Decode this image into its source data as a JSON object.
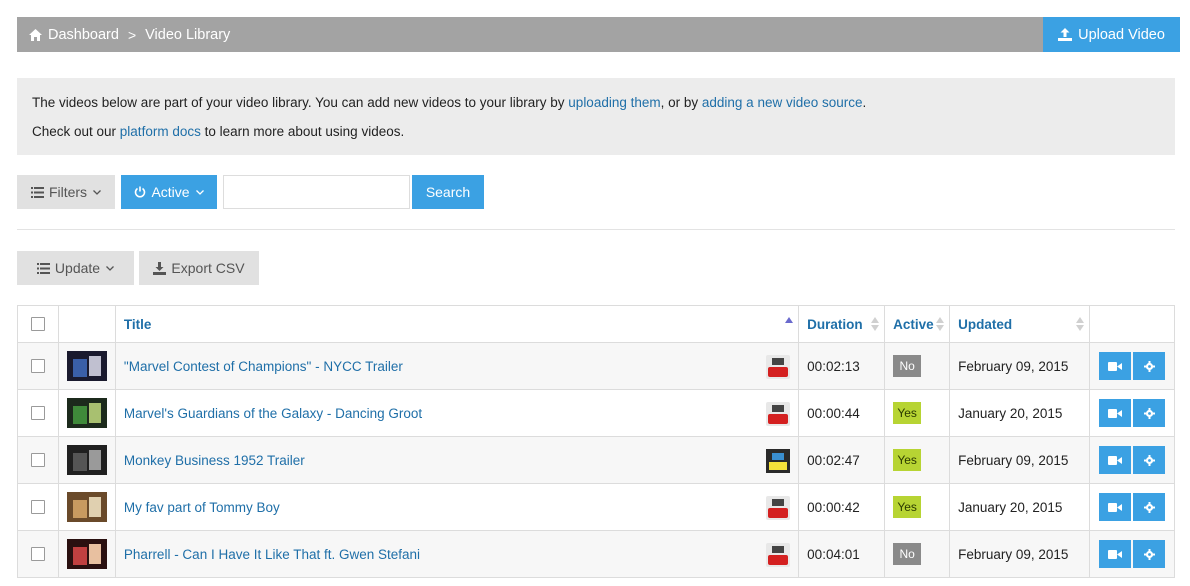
{
  "breadcrumb": {
    "home_icon": "home-icon",
    "dashboard": "Dashboard",
    "separator": ">",
    "current": "Video Library"
  },
  "upload_button": {
    "label": "Upload Video",
    "icon": "upload-icon"
  },
  "info": {
    "line1_prefix": "The videos below are part of your video library. You can add new videos to your library by ",
    "link_upload": "uploading them",
    "line1_mid": ", or by ",
    "link_source": "adding a new video source",
    "line1_suffix": ".",
    "line2_prefix": "Check out our ",
    "link_docs": "platform docs",
    "line2_suffix": " to learn more about using videos."
  },
  "filters": {
    "filters_label": "Filters",
    "active_label": "Active",
    "search_value": "",
    "search_button": "Search"
  },
  "bulk": {
    "update_label": "Update",
    "export_label": "Export CSV"
  },
  "table": {
    "headers": {
      "title": "Title",
      "duration": "Duration",
      "active": "Active",
      "updated": "Updated"
    },
    "rows": [
      {
        "title": "\"Marvel Contest of Champions\" - NYCC Trailer",
        "source": "youtube",
        "duration": "00:02:13",
        "active": "No",
        "updated": "February 09, 2015"
      },
      {
        "title": "Marvel's Guardians of the Galaxy - Dancing Groot",
        "source": "youtube",
        "duration": "00:00:44",
        "active": "Yes",
        "updated": "January 20, 2015"
      },
      {
        "title": "Monkey Business 1952 Trailer",
        "source": "zype",
        "duration": "00:02:47",
        "active": "Yes",
        "updated": "February 09, 2015"
      },
      {
        "title": "My fav part of Tommy Boy",
        "source": "youtube",
        "duration": "00:00:42",
        "active": "Yes",
        "updated": "January 20, 2015"
      },
      {
        "title": "Pharrell - Can I Have It Like That ft. Gwen Stefani",
        "source": "youtube",
        "duration": "00:04:01",
        "active": "No",
        "updated": "February 09, 2015"
      }
    ]
  },
  "colors": {
    "accent": "#3ba1e3",
    "topbar": "#a3a3a3",
    "link": "#1f6fa8",
    "badge_yes": "#b7d433",
    "badge_no": "#8a8a8a"
  }
}
